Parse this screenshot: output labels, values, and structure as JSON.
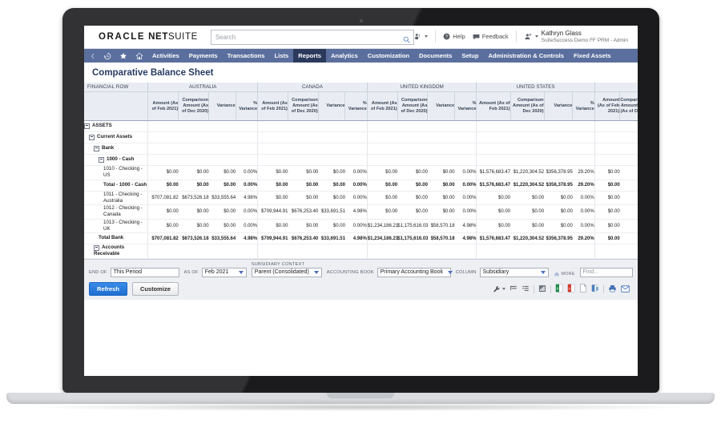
{
  "app": {
    "brand_oracle": "ORACLE",
    "brand_netsuite_bold": "NET",
    "brand_netsuite_light": "SUITE"
  },
  "search": {
    "placeholder": "Search",
    "value": "",
    "icon": "search-icon"
  },
  "header": {
    "help_label": "Help",
    "feedback_label": "Feedback",
    "user_name": "Kathryn Glass",
    "user_role": "SuiteSuccess Demo FF PRM - Admin",
    "switch_role_icon": "user-switch-icon",
    "apps_icon": "apps-icon"
  },
  "nav": {
    "items": [
      {
        "label": "",
        "icon": "collapse-icon",
        "active": false
      },
      {
        "label": "",
        "icon": "recent-history-icon",
        "active": false
      },
      {
        "label": "",
        "icon": "star-icon",
        "active": false
      },
      {
        "label": "",
        "icon": "home-icon",
        "active": false
      },
      {
        "label": "Activities",
        "active": false
      },
      {
        "label": "Payments",
        "active": false
      },
      {
        "label": "Transactions",
        "active": false
      },
      {
        "label": "Lists",
        "active": false
      },
      {
        "label": "Reports",
        "active": true
      },
      {
        "label": "Analytics",
        "active": false
      },
      {
        "label": "Customization",
        "active": false
      },
      {
        "label": "Documents",
        "active": false
      },
      {
        "label": "Setup",
        "active": false
      },
      {
        "label": "Administration & Controls",
        "active": false
      },
      {
        "label": "Fixed Assets",
        "active": false
      }
    ]
  },
  "report": {
    "title": "Comparative Balance Sheet",
    "first_column_header": "FINANCIAL ROW",
    "region_groups": [
      {
        "label": "AUSTRALIA",
        "span": 4
      },
      {
        "label": "CANADA",
        "span": 4
      },
      {
        "label": "UNITED KINGDOM",
        "span": 4
      },
      {
        "label": "UNITED STATES",
        "span": 4
      },
      {
        "label": "",
        "span": 2
      }
    ],
    "column_headers": [
      "Amount (As of Feb 2021)",
      "Comparison Amount (As of Dec 2020)",
      "Variance",
      "% Variance"
    ],
    "last_partial_headers": [
      "Amount (As of Feb 2021)",
      "Comparison Amount (As of D"
    ],
    "rows": [
      {
        "label": "ASSETS",
        "indent": 0,
        "twisty": true,
        "bold": true,
        "values": []
      },
      {
        "label": "Current Assets",
        "indent": 1,
        "twisty": true,
        "bold": true,
        "values": []
      },
      {
        "label": "Bank",
        "indent": 2,
        "twisty": true,
        "bold": true,
        "values": []
      },
      {
        "label": "1000 - Cash",
        "indent": 3,
        "twisty": true,
        "bold": true,
        "values": []
      },
      {
        "label": "1010 - Checking - US",
        "indent": 4,
        "twisty": false,
        "bold": false,
        "values": [
          "$0.00",
          "$0.00",
          "$0.00",
          "0.00%",
          "$0.00",
          "$0.00",
          "$0.00",
          "0.00%",
          "$0.00",
          "$0.00",
          "$0.00",
          "0.00%",
          "$1,576,683.47",
          "$1,220,304.52",
          "$356,378.95",
          "29.20%",
          "$0.00",
          ""
        ]
      },
      {
        "label": "Total - 1000 - Cash",
        "indent": 4,
        "twisty": false,
        "bold": true,
        "total_top": true,
        "values": [
          "$0.00",
          "$0.00",
          "$0.00",
          "0.00%",
          "$0.00",
          "$0.00",
          "$0.00",
          "0.00%",
          "$0.00",
          "$0.00",
          "$0.00",
          "0.00%",
          "$1,576,683.47",
          "$1,220,304.52",
          "$356,378.95",
          "29.20%",
          "$0.00",
          ""
        ]
      },
      {
        "label": "1011 - Checking - Australia",
        "indent": 4,
        "twisty": false,
        "bold": false,
        "values": [
          "$707,081.82",
          "$673,526.18",
          "$33,555.64",
          "4.98%",
          "$0.00",
          "$0.00",
          "$0.00",
          "0.00%",
          "$0.00",
          "$0.00",
          "$0.00",
          "0.00%",
          "$0.00",
          "$0.00",
          "$0.00",
          "0.00%",
          "$0.00",
          ""
        ]
      },
      {
        "label": "1012 - Checking - Canada",
        "indent": 4,
        "twisty": false,
        "bold": false,
        "values": [
          "$0.00",
          "$0.00",
          "$0.00",
          "0.00%",
          "$709,944.91",
          "$676,253.40",
          "$33,691.51",
          "4.98%",
          "$0.00",
          "$0.00",
          "$0.00",
          "0.00%",
          "$0.00",
          "$0.00",
          "$0.00",
          "0.00%",
          "$0.00",
          ""
        ]
      },
      {
        "label": "1013 - Checking - UK",
        "indent": 4,
        "twisty": false,
        "bold": false,
        "values": [
          "$0.00",
          "$0.00",
          "$0.00",
          "0.00%",
          "$0.00",
          "$0.00",
          "$0.00",
          "0.00%",
          "$1,234,186.21",
          "$1,175,616.03",
          "$58,570.18",
          "4.98%",
          "$0.00",
          "$0.00",
          "$0.00",
          "0.00%",
          "$0.00",
          ""
        ]
      },
      {
        "label": "Total Bank",
        "indent": 3,
        "twisty": false,
        "bold": true,
        "total_top": true,
        "values": [
          "$707,081.82",
          "$673,526.18",
          "$33,555.64",
          "4.98%",
          "$709,944.91",
          "$676,253.40",
          "$33,691.51",
          "4.98%",
          "$1,234,186.21",
          "$1,175,616.03",
          "$58,570.18",
          "4.98%",
          "$1,576,683.47",
          "$1,220,304.52",
          "$356,378.95",
          "29.20%",
          "$0.00",
          ""
        ]
      },
      {
        "label": "Accounts Receivable",
        "indent": 2,
        "twisty": true,
        "bold": true,
        "clipped": true,
        "values": []
      }
    ]
  },
  "controls": {
    "end_of_label": "END OF",
    "end_of_value": "This Period",
    "as_of_label": "AS OF",
    "as_of_value": "Feb 2021",
    "subsidiary_context_label": "SUBSIDIARY CONTEXT",
    "subsidiary_context_value": "Parent (Consolidated)",
    "accounting_book_label": "ACCOUNTING BOOK",
    "accounting_book_value": "Primary Accounting Book",
    "column_label": "COLUMN",
    "column_value": "Subsidiary",
    "more_label": "MORE",
    "find_placeholder": "Find...",
    "refresh_label": "Refresh",
    "customize_label": "Customize"
  },
  "toolbar_icons": [
    "wrench-options-icon",
    "collapse-one-level-icon",
    "expand-all-levels-icon",
    "chart-icon",
    "export-excel-icon",
    "export-pdf-icon",
    "export-word-icon",
    "export-csv-icon",
    "print-icon",
    "email-icon"
  ],
  "colors": {
    "nav_bar": "#5b6f9e",
    "nav_active": "#2b3a5c",
    "title": "#2a3b63",
    "primary_button": "#2477d8",
    "header_band": "#e9edf3",
    "excel_green": "#1d8b4a",
    "pdf_red": "#d3382a",
    "doc_blue": "#4a7fc1"
  }
}
